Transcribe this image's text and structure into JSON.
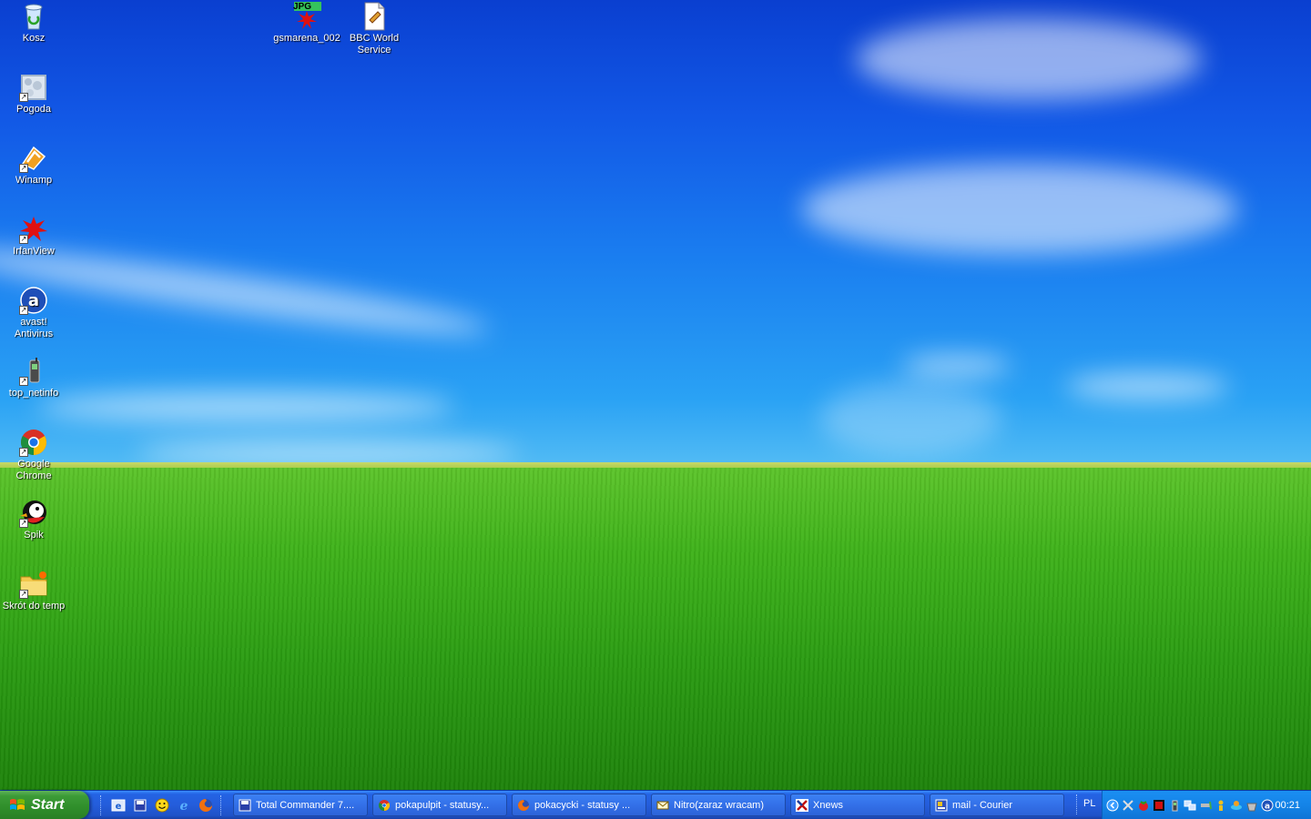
{
  "desktop": {
    "icons": [
      {
        "label": "Kosz",
        "icon": "recycle-bin-icon"
      },
      {
        "label": "Pogoda",
        "icon": "weather-icon"
      },
      {
        "label": "Winamp",
        "icon": "winamp-icon"
      },
      {
        "label": "IrfanView",
        "icon": "irfanview-icon"
      },
      {
        "label": "avast!\nAntivirus",
        "icon": "avast-icon"
      },
      {
        "label": "top_netinfo",
        "icon": "phone-icon"
      },
      {
        "label": "Google\nChrome",
        "icon": "chrome-icon"
      },
      {
        "label": "Spik",
        "icon": "spik-icon"
      },
      {
        "label": "Skrót do temp",
        "icon": "folder-icon"
      },
      {
        "label": "gsmarena_002",
        "icon": "jpg-file-icon",
        "badge": "JPG"
      },
      {
        "label": "BBC World\nService",
        "icon": "document-icon"
      }
    ]
  },
  "taskbar": {
    "start_label": "Start",
    "quick_launch": [
      "ie-icon",
      "save-icon",
      "smiley-icon",
      "ie-alt-icon",
      "firefox-icon"
    ],
    "tasks": [
      {
        "label": "Total Commander 7....",
        "icon": "floppy-icon"
      },
      {
        "label": "pokapulpit - statusy...",
        "icon": "chrome-icon"
      },
      {
        "label": "pokacycki - statusy ...",
        "icon": "firefox-icon"
      },
      {
        "label": "Nitro(zaraz wracam)",
        "icon": "envelope-icon"
      },
      {
        "label": "Xnews",
        "icon": "xnews-icon"
      },
      {
        "label": "mail - Courier",
        "icon": "courier-icon"
      }
    ],
    "language": "PL",
    "clock": "00:21"
  }
}
